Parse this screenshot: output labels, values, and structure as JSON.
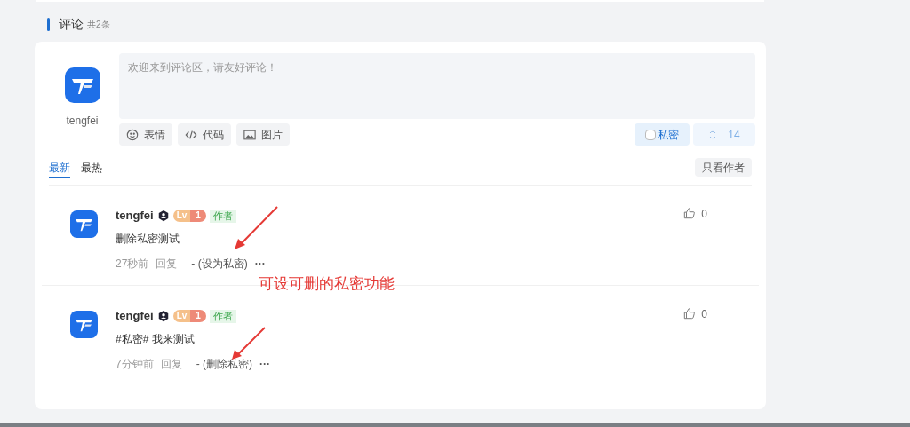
{
  "section": {
    "title": "评论",
    "count": "共2条"
  },
  "editor": {
    "user": "tengfei",
    "placeholder": "欢迎来到评论区，请友好评论！",
    "tools": [
      {
        "kind": "emoji",
        "label": "表情"
      },
      {
        "kind": "code",
        "label": "代码"
      },
      {
        "kind": "image",
        "label": "图片"
      }
    ],
    "private": {
      "label": "私密",
      "checked": false
    },
    "submit": {
      "label": "14"
    }
  },
  "tabs": [
    {
      "label": "最新",
      "selected": true
    },
    {
      "label": "最热",
      "selected": false
    }
  ],
  "filter": "只看作者",
  "comments": [
    {
      "user": "tengfei",
      "level": [
        "Lv",
        "1"
      ],
      "role": "作者",
      "text": "删除私密测试",
      "time": "27秒前",
      "reply": "回复",
      "action": "- (设为私密)",
      "more": "···",
      "likes": "0"
    },
    {
      "user": "tengfei",
      "level": [
        "Lv",
        "1"
      ],
      "role": "作者",
      "text": "#私密# 我来测试",
      "time": "7分钟前",
      "reply": "回复",
      "action": "- (删除私密)",
      "more": "···",
      "likes": "0"
    }
  ],
  "annotation": {
    "text": "可设可删的私密功能"
  }
}
